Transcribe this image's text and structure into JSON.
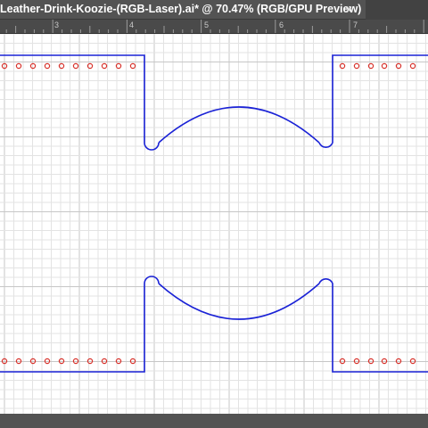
{
  "document_tab": {
    "title": "Leather-Drink-Koozie-(RGB-Laser).ai* @ 70.47% (RGB/GPU Preview)",
    "close_glyph": "✕"
  },
  "ruler": {
    "numbers": [
      "3",
      "4",
      "5",
      "6",
      "7"
    ]
  },
  "artwork": {
    "outline_color": "#1a22d6",
    "hole_color": "#d8312a",
    "shapes": [
      "top-left-panel",
      "top-right-panel",
      "top-scallop",
      "bottom-left-panel",
      "bottom-right-panel",
      "bottom-scallop"
    ]
  },
  "colors": {
    "ui_background": "#535353",
    "canvas_background": "#ffffff",
    "grid_minor": "#e3e3e3",
    "grid_major": "#c7c7c7"
  },
  "icons": [
    "close-icon"
  ]
}
